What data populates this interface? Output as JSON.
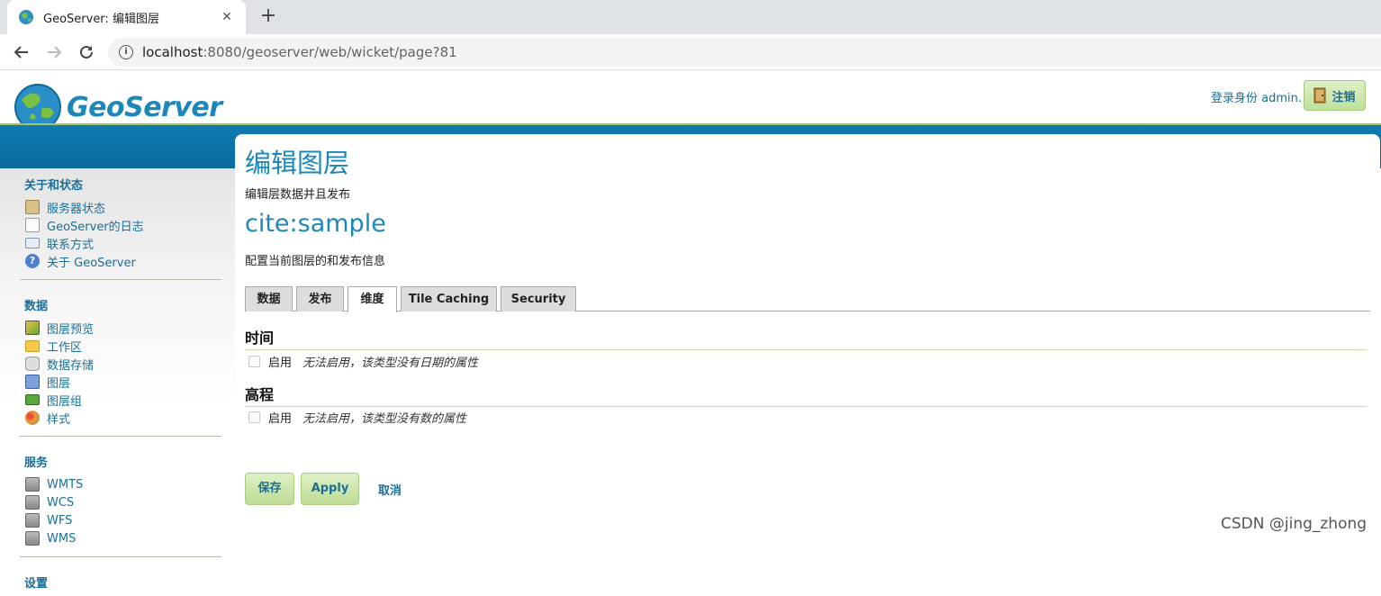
{
  "browser": {
    "tab_title": "GeoServer: 编辑图层",
    "tab_close": "✕",
    "new_tab": "+",
    "url_host": "localhost",
    "url_rest": ":8080/geoserver/web/wicket/page?81"
  },
  "header": {
    "logo_text": "GeoServer",
    "login_text": "登录身份 admin.",
    "logout_label": "注销"
  },
  "sidebar": {
    "sections": [
      {
        "title": "关于和状态",
        "items": [
          "服务器状态",
          "GeoServer的日志",
          "联系方式",
          "关于 GeoServer"
        ]
      },
      {
        "title": "数据",
        "items": [
          "图层预览",
          "工作区",
          "数据存储",
          "图层",
          "图层组",
          "样式"
        ]
      },
      {
        "title": "服务",
        "items": [
          "WMTS",
          "WCS",
          "WFS",
          "WMS"
        ]
      },
      {
        "title": "设置",
        "items": []
      }
    ]
  },
  "main": {
    "title": "编辑图层",
    "description": "编辑层数据并且发布",
    "layer_name": "cite:sample",
    "layer_description": "配置当前图层的和发布信息",
    "tabs": [
      "数据",
      "发布",
      "维度",
      "Tile Caching",
      "Security"
    ],
    "active_tab": "维度",
    "sections": [
      {
        "heading": "时间",
        "enable_label": "启用",
        "note": "无法启用，该类型没有日期的属性"
      },
      {
        "heading": "高程",
        "enable_label": "启用",
        "note": "无法启用，该类型没有数的属性"
      }
    ],
    "buttons": {
      "save": "保存",
      "apply": "Apply",
      "cancel": "取消"
    }
  },
  "watermark": "CSDN @jing_zhong",
  "colors": {
    "link": "#1a6f96",
    "title": "#1c87b8",
    "band": "#107bb0",
    "button": "#bddc95"
  }
}
